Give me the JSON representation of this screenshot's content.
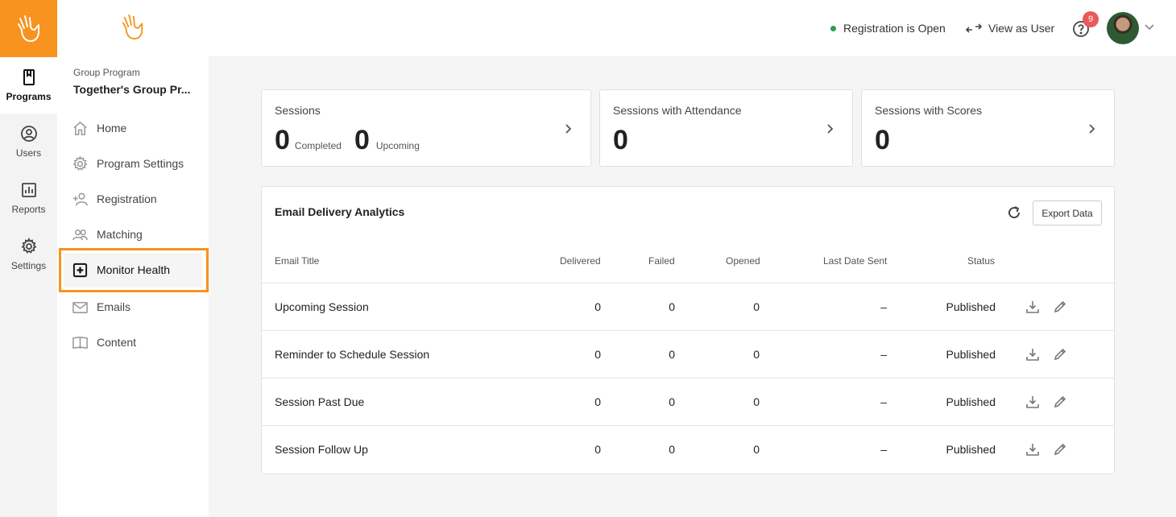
{
  "rail": {
    "items": [
      {
        "label": "Programs",
        "icon": "book-icon"
      },
      {
        "label": "Users",
        "icon": "user-circle-icon"
      },
      {
        "label": "Reports",
        "icon": "bar-chart-icon"
      },
      {
        "label": "Settings",
        "icon": "gear-icon"
      }
    ]
  },
  "sidebar": {
    "kicker": "Group Program",
    "program_name": "Together's Group Pr...",
    "items": [
      {
        "label": "Home",
        "icon": "home-icon"
      },
      {
        "label": "Program Settings",
        "icon": "gear-icon"
      },
      {
        "label": "Registration",
        "icon": "add-person-icon"
      },
      {
        "label": "Matching",
        "icon": "people-icon"
      },
      {
        "label": "Monitor Health",
        "icon": "medical-cross-icon"
      },
      {
        "label": "Emails",
        "icon": "envelope-icon"
      },
      {
        "label": "Content",
        "icon": "open-book-icon"
      }
    ]
  },
  "header": {
    "registration_status": "Registration is Open",
    "view_as_user": "View as User",
    "notifications_count": "9"
  },
  "cards": {
    "sessions": {
      "title": "Sessions",
      "completed_value": "0",
      "completed_label": "Completed",
      "upcoming_value": "0",
      "upcoming_label": "Upcoming"
    },
    "attendance": {
      "title": "Sessions with Attendance",
      "value": "0"
    },
    "scores": {
      "title": "Sessions with Scores",
      "value": "0"
    }
  },
  "analytics": {
    "title": "Email Delivery Analytics",
    "export_label": "Export Data",
    "columns": [
      "Email Title",
      "Delivered",
      "Failed",
      "Opened",
      "Last Date Sent",
      "Status"
    ],
    "rows": [
      {
        "title": "Upcoming Session",
        "delivered": "0",
        "failed": "0",
        "opened": "0",
        "last_sent": "–",
        "status": "Published"
      },
      {
        "title": "Reminder to Schedule Session",
        "delivered": "0",
        "failed": "0",
        "opened": "0",
        "last_sent": "–",
        "status": "Published"
      },
      {
        "title": "Session Past Due",
        "delivered": "0",
        "failed": "0",
        "opened": "0",
        "last_sent": "–",
        "status": "Published"
      },
      {
        "title": "Session Follow Up",
        "delivered": "0",
        "failed": "0",
        "opened": "0",
        "last_sent": "–",
        "status": "Published"
      }
    ]
  },
  "colors": {
    "brand": "#f7931e",
    "status_open": "#2e9e4b",
    "badge": "#e85a5a"
  }
}
